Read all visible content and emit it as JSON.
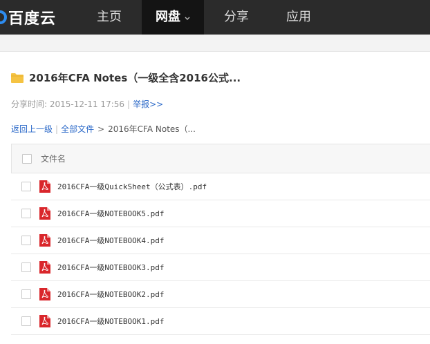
{
  "brand": {
    "name": "百度云"
  },
  "nav": {
    "items": [
      {
        "label": "主页",
        "active": false
      },
      {
        "label": "网盘",
        "active": true,
        "has_dropdown": true
      },
      {
        "label": "分享",
        "active": false
      },
      {
        "label": "应用",
        "active": false
      }
    ]
  },
  "share": {
    "title": "2016年CFA Notes（一级全含2016公式...",
    "time_label": "分享时间:",
    "time_value": "2015-12-11 17:56",
    "report_link": "举报>>"
  },
  "breadcrumb": {
    "back": "返回上一级",
    "all_files": "全部文件",
    "current": "2016年CFA Notes（..."
  },
  "table": {
    "column_name": "文件名",
    "files": [
      {
        "name": "2016CFA一级QuickSheet（公式表）.pdf",
        "icon": "pdf-icon"
      },
      {
        "name": "2016CFA一级NOTEBOOK5.pdf",
        "icon": "pdf-icon"
      },
      {
        "name": "2016CFA一级NOTEBOOK4.pdf",
        "icon": "pdf-icon"
      },
      {
        "name": "2016CFA一级NOTEBOOK3.pdf",
        "icon": "pdf-icon"
      },
      {
        "name": "2016CFA一级NOTEBOOK2.pdf",
        "icon": "pdf-icon"
      },
      {
        "name": "2016CFA一级NOTEBOOK1.pdf",
        "icon": "pdf-icon"
      }
    ]
  },
  "colors": {
    "nav_bg": "#2b2b2b",
    "nav_active_bg": "#141414",
    "link": "#2a68c8",
    "pdf_red": "#d9262b",
    "folder_yellow": "#f5c342"
  }
}
